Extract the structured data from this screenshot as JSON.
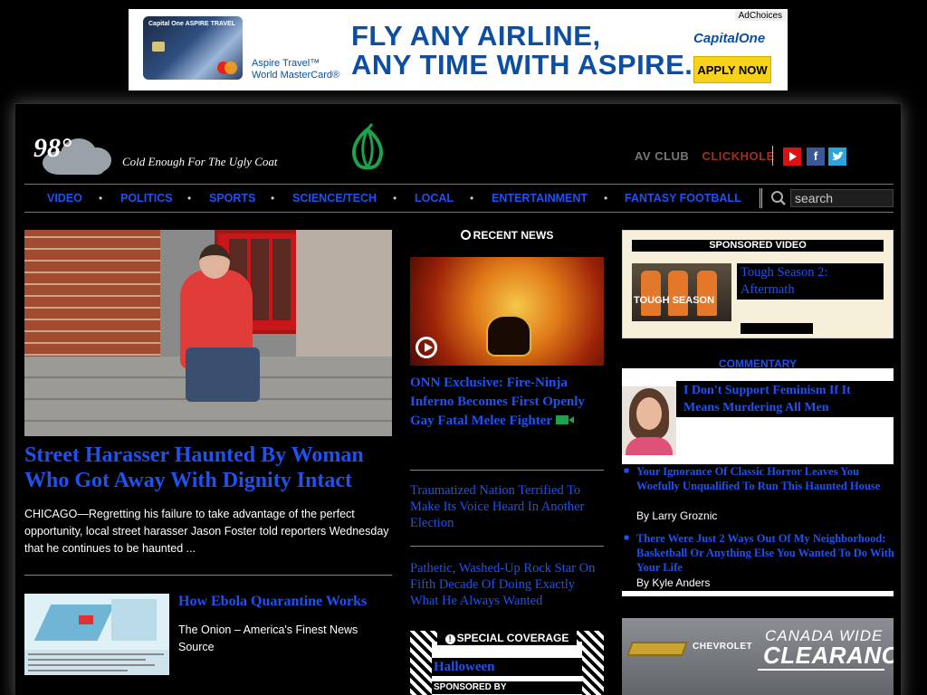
{
  "top_ad": {
    "card_brand": "Capital One  ASPIRE TRAVEL",
    "card_name_1": "Aspire Travel™",
    "card_name_2": "World MasterCard®",
    "headline_1": "FLY ANY AIRLINE,",
    "headline_2": "ANY TIME WITH ASPIRE.",
    "adchoices": "AdChoices",
    "brand": "CapitalOne",
    "cta": "APPLY NOW"
  },
  "header": {
    "temperature": "98°",
    "tagline": "Cold Enough For The Ugly Coat",
    "logo_icon": "onion-logo-icon",
    "link_avclub": "AV CLUB",
    "link_clickhole": "CLICKHOLE",
    "social": [
      "youtube-icon",
      "facebook-icon",
      "twitter-icon"
    ],
    "facebook_glyph": "f"
  },
  "nav": {
    "items": [
      "VIDEO",
      "POLITICS",
      "SPORTS",
      "SCIENCE/TECH",
      "LOCAL",
      "ENTERTAINMENT",
      "FANTASY FOOTBALL"
    ],
    "separator": "•",
    "search_placeholder": "search"
  },
  "hero": {
    "title": "Street Harasser Haunted By Woman Who Got Away With Dignity Intact",
    "body": "CHICAGO—Regretting his failure to take advantage of the perfect opportunity, local street harasser Jason Foster told reporters Wednesday that he continues to be haunted ..."
  },
  "secondary": {
    "title": "How Ebola Quarantine Works",
    "body": "The Onion – America's Finest News Source"
  },
  "recent_news": {
    "heading": "RECENT NEWS",
    "featured_title": "ONN Exclusive: Fire-Ninja Inferno Becomes First Openly Gay Fatal Melee Fighter",
    "stories": [
      "Traumatized Nation Terrified To Make Its Voice Heard In Another Election",
      "Pathetic, Washed-Up Rock Star On Fifth Decade Of Doing Exactly What He Always Wanted"
    ]
  },
  "special_coverage": {
    "label": "SPECIAL COVERAGE",
    "title": "Halloween",
    "sponsored_by": "SPONSORED BY"
  },
  "sponsored_video": {
    "label": "SPONSORED VIDEO",
    "title": "Tough Season 2: Aftermath",
    "thumb_text": "TOUGH SEASON"
  },
  "commentary": {
    "heading": "COMMENTARY",
    "featured_title": "I Don't Support Feminism If It Means Murdering All Men",
    "items": [
      {
        "title": "Your Ignorance Of Classic Horror Leaves You Woefully Unqualified To Run This Haunted House",
        "byline": "By Larry Groznic"
      },
      {
        "title": "There Were Just 2 Ways Out Of My Neighborhood: Basketball Or Anything Else You Wanted To Do With Your Life",
        "byline": "By Kyle Anders"
      }
    ]
  },
  "chevy_ad": {
    "brand": "CHEVROLET",
    "line1": "CANADA WIDE",
    "line2": "CLEARANCE"
  },
  "colors": {
    "link_blue": "#1f52f0",
    "background": "#000000",
    "ad_blue": "#0b4ea2",
    "cta_yellow": "#f6d21a"
  }
}
